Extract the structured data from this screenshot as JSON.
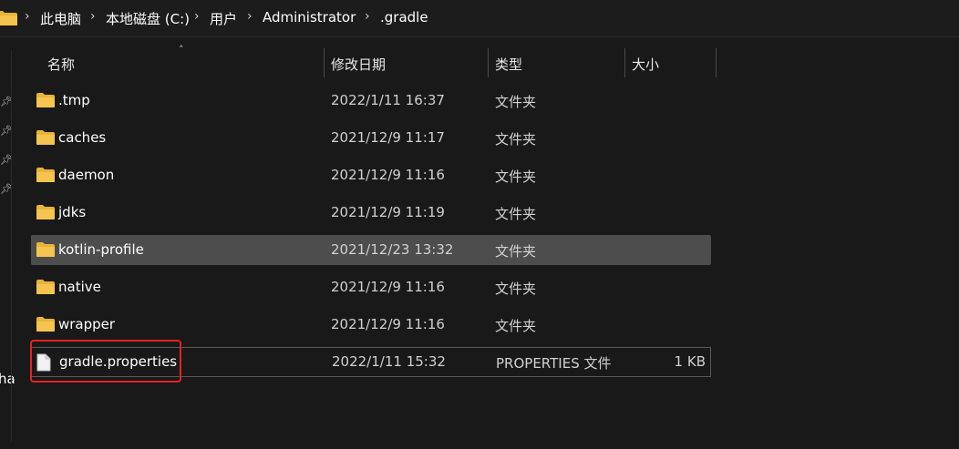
{
  "breadcrumb": {
    "items": [
      "此电脑",
      "本地磁盘 (C:)",
      "用户",
      "Administrator",
      ".gradle"
    ],
    "separator": "›"
  },
  "nav": {
    "partial_label": "ha"
  },
  "columns": {
    "name": "名称",
    "date": "修改日期",
    "type": "类型",
    "size": "大小"
  },
  "files": [
    {
      "name": ".tmp",
      "date": "2022/1/11 16:37",
      "type": "文件夹",
      "size": "",
      "icon": "folder-icon"
    },
    {
      "name": "caches",
      "date": "2021/12/9 11:17",
      "type": "文件夹",
      "size": "",
      "icon": "folder-icon"
    },
    {
      "name": "daemon",
      "date": "2021/12/9 11:16",
      "type": "文件夹",
      "size": "",
      "icon": "folder-icon"
    },
    {
      "name": "jdks",
      "date": "2021/12/9 11:19",
      "type": "文件夹",
      "size": "",
      "icon": "folder-icon"
    },
    {
      "name": "kotlin-profile",
      "date": "2021/12/23 13:32",
      "type": "文件夹",
      "size": "",
      "icon": "folder-icon"
    },
    {
      "name": "native",
      "date": "2021/12/9 11:16",
      "type": "文件夹",
      "size": "",
      "icon": "folder-icon"
    },
    {
      "name": "wrapper",
      "date": "2021/12/9 11:16",
      "type": "文件夹",
      "size": "",
      "icon": "folder-icon"
    },
    {
      "name": "gradle.properties",
      "date": "2022/1/11 15:32",
      "type": "PROPERTIES 文件",
      "size": "1 KB",
      "icon": "file-icon"
    }
  ],
  "colors": {
    "background": "#191919",
    "selected_row": "#4d4d4d",
    "folder": "#f4c44e",
    "highlight": "#e8211f"
  }
}
